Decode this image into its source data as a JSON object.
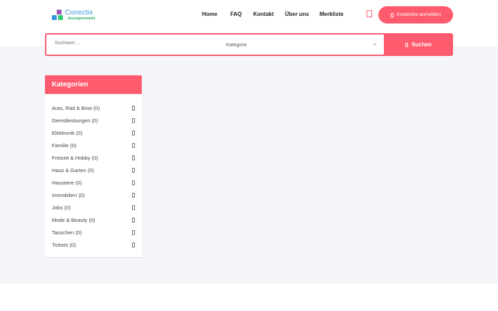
{
  "brand": {
    "name": "Conectix",
    "tagline": "Anzeigenmarkt"
  },
  "nav": [
    {
      "label": "Home"
    },
    {
      "label": "FAQ"
    },
    {
      "label": "Kontakt"
    },
    {
      "label": "Über uns"
    },
    {
      "label": "Merkliste"
    }
  ],
  "header": {
    "register_label": "Kostenlos anmelden"
  },
  "search": {
    "placeholder": "Suchwort ...",
    "category_label": "Kategorie",
    "button_label": "Suchen"
  },
  "sidebar": {
    "title": "Kategorien",
    "items": [
      {
        "label": "Auto, Rad & Boot (0)"
      },
      {
        "label": "Dienstleistungen (0)"
      },
      {
        "label": "Elektronik (0)"
      },
      {
        "label": "Familie (0)"
      },
      {
        "label": "Freizeit & Hobby (0)"
      },
      {
        "label": "Haus & Garten (0)"
      },
      {
        "label": "Haustiere (0)"
      },
      {
        "label": "Immobilien (0)"
      },
      {
        "label": "Jobs (0)"
      },
      {
        "label": "Mode & Beauty (0)"
      },
      {
        "label": "Tauschen (0)"
      },
      {
        "label": "Tickets (0)"
      }
    ]
  },
  "colors": {
    "accent": "#ff5b6e",
    "background_band": "#f4f5f9"
  },
  "icons": {
    "heart": "heart-icon",
    "register": "user-icon",
    "search": "search-icon",
    "dropdown": "chevron-down-icon",
    "item_arrow": "chevron-right-icon"
  }
}
